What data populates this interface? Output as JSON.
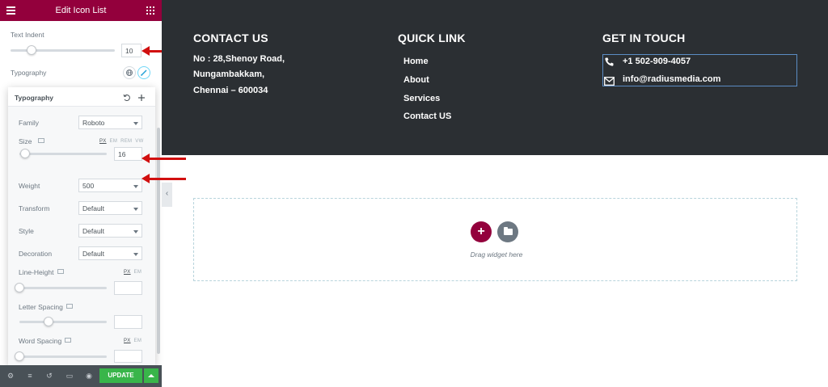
{
  "panel": {
    "title": "Edit Icon List",
    "text_indent": {
      "label": "Text Indent",
      "value": "10",
      "slider_fraction": 0.2
    },
    "typography": {
      "label": "Typography"
    }
  },
  "typography_popover": {
    "title": "Typography",
    "family": {
      "label": "Family",
      "value": "Roboto"
    },
    "size": {
      "label": "Size",
      "value": "16",
      "units": [
        "PX",
        "EM",
        "REM",
        "VW"
      ],
      "active_unit": "PX",
      "slider_fraction": 0.05
    },
    "weight": {
      "label": "Weight",
      "value": "500"
    },
    "transform": {
      "label": "Transform",
      "value": "Default"
    },
    "style": {
      "label": "Style",
      "value": "Default"
    },
    "decoration": {
      "label": "Decoration",
      "value": "Default"
    },
    "line_height": {
      "label": "Line-Height",
      "units": [
        "PX",
        "EM"
      ],
      "value": ""
    },
    "letter_spacing": {
      "label": "Letter Spacing",
      "value": ""
    },
    "word_spacing": {
      "label": "Word Spacing",
      "units": [
        "PX",
        "EM"
      ],
      "value": ""
    }
  },
  "footer_bar": {
    "update_label": "UPDATE"
  },
  "preview": {
    "contact": {
      "heading": "CONTACT US",
      "lines": [
        "No : 28,Shenoy Road,",
        "Nungambakkam,",
        "Chennai – 600034"
      ]
    },
    "quick_link": {
      "heading": "QUICK LINK",
      "links": [
        "Home",
        "About",
        "Services",
        "Contact US"
      ]
    },
    "get_in_touch": {
      "heading": "GET IN TOUCH",
      "phone": "+1 502-909-4057",
      "email": "info@radiusmedia.com"
    },
    "drop_zone": {
      "text": "Drag widget here"
    }
  },
  "colors": {
    "brand": "#93003c",
    "dark_bg": "#2b2f33",
    "update_green": "#39b54a",
    "arrow_red": "#d10f0f"
  },
  "icons": [
    "hamburger-icon",
    "grid-icon",
    "globe-icon",
    "pencil-icon",
    "reset-icon",
    "plus-icon",
    "monitor-icon",
    "settings-icon",
    "layers-icon",
    "history-icon",
    "responsive-icon",
    "eye-icon",
    "phone-icon",
    "envelope-icon",
    "folder-icon"
  ]
}
